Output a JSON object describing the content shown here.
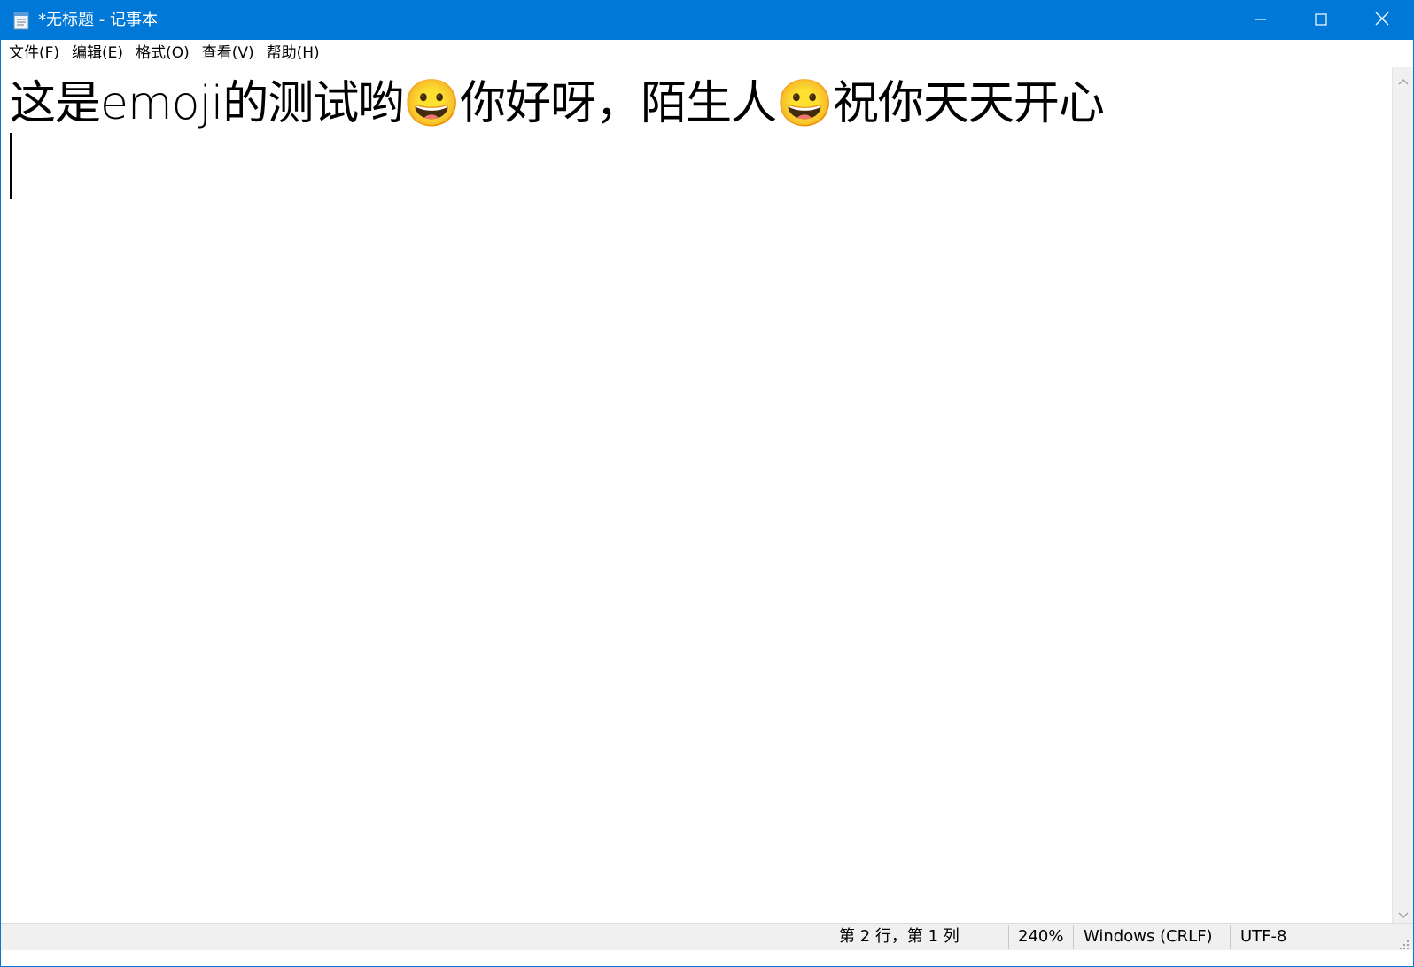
{
  "window": {
    "title": "*无标题 - 记事本",
    "accent_color": "#0078d7",
    "app_icon": "notepad-icon",
    "controls": {
      "minimize_icon": "minimize-icon",
      "maximize_icon": "maximize-icon",
      "close_icon": "close-icon"
    }
  },
  "menubar": {
    "items": [
      {
        "label": "文件(F)"
      },
      {
        "label": "编辑(E)"
      },
      {
        "label": "格式(O)"
      },
      {
        "label": "查看(V)"
      },
      {
        "label": "帮助(H)"
      }
    ]
  },
  "editor": {
    "lines": [
      "这是emoji的测试哟😀你好呀，陌生人😀祝你天天开心",
      ""
    ],
    "caret_line": 2,
    "caret_column": 1
  },
  "statusbar": {
    "position": "第 2 行，第 1 列",
    "zoom": "240%",
    "line_ending": "Windows (CRLF)",
    "encoding": "UTF-8"
  }
}
